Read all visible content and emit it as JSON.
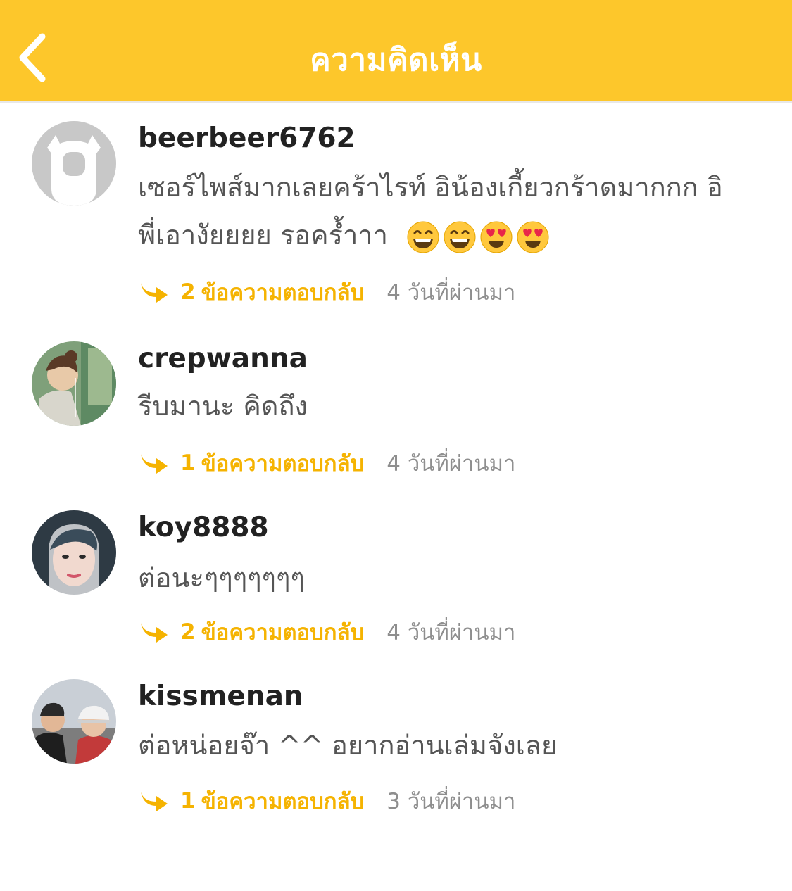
{
  "header": {
    "title": "ความคิดเห็น",
    "back_icon": "chevron-left-icon",
    "background_color": "#FDC72B"
  },
  "reply_label": "ข้อความตอบกลับ",
  "comments": [
    {
      "username": "beerbeer6762",
      "text_line1": "เซอร์ไพส์มากเลยคร้าไรท์  อิน้องเกี้ยวกร้าดมากกก  อิ",
      "text_line2": "พี่เอางัยยยย   รอคร้ำาา",
      "emojis": [
        "grinning-face",
        "grinning-face",
        "heart-eyes",
        "heart-eyes"
      ],
      "reply_count": "2",
      "time_ago": "4 วันที่ผ่านมา",
      "avatar": "default-avatar"
    },
    {
      "username": "crepwanna",
      "text": "รีบมานะ คิดถึง",
      "reply_count": "1",
      "time_ago": "4 วันที่ผ่านมา",
      "avatar": "user-photo"
    },
    {
      "username": "koy8888",
      "text": "ต่อนะๆๆๆๆๆๆๆ",
      "reply_count": "2",
      "time_ago": "4 วันที่ผ่านมา",
      "avatar": "user-photo"
    },
    {
      "username": "kissmenan",
      "text": "ต่อหน่อยจ๊า ^^ อยากอ่านเล่มจังเลย",
      "reply_count": "1",
      "time_ago": "3 วันที่ผ่านมา",
      "avatar": "user-photo"
    }
  ],
  "colors": {
    "accent": "#F5B301",
    "meta_gray": "#8E8E8E",
    "text_gray": "#555555"
  }
}
